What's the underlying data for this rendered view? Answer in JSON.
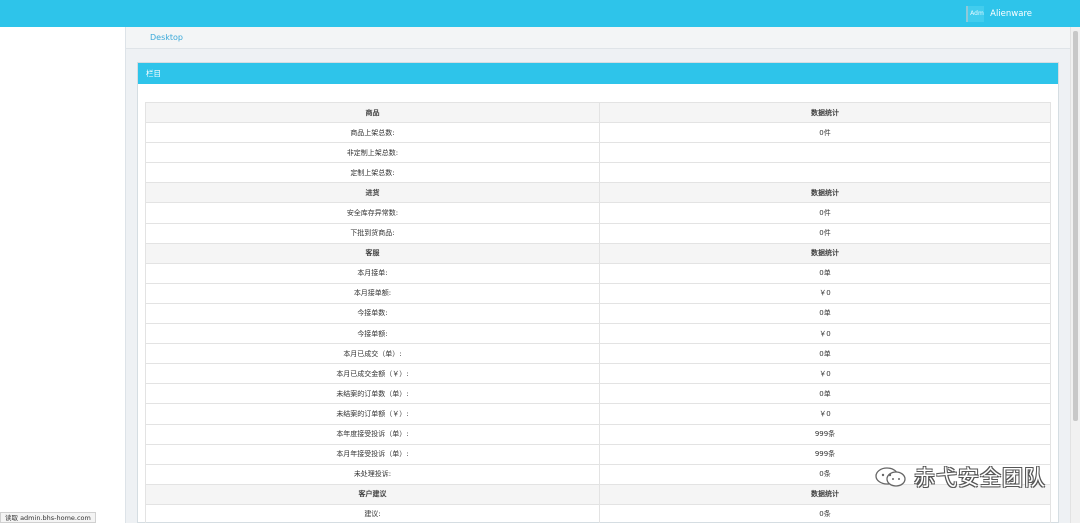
{
  "header": {
    "avatar_text": "Adm",
    "username": "Alienware"
  },
  "breadcrumb": {
    "label": "Desktop"
  },
  "panel": {
    "title": "栏目"
  },
  "stats_table": {
    "sections": [
      {
        "title": "商品",
        "stat_header": "数据统计",
        "rows": [
          {
            "label": "商品上架总数:",
            "value": "0件"
          },
          {
            "label": "非定制上架总数:",
            "value": ""
          },
          {
            "label": "定制上架总数:",
            "value": ""
          }
        ]
      },
      {
        "title": "进货",
        "stat_header": "数据统计",
        "rows": [
          {
            "label": "安全库存异常数:",
            "value": "0件"
          },
          {
            "label": "下批到货商品:",
            "value": "0件"
          }
        ]
      },
      {
        "title": "客服",
        "stat_header": "数据统计",
        "rows": [
          {
            "label": "本月接单:",
            "value": "0单"
          },
          {
            "label": "本月接单额:",
            "value": "￥0"
          },
          {
            "label": "今接单数:",
            "value": "0单"
          },
          {
            "label": "今接单额:",
            "value": "￥0"
          },
          {
            "label": "本月已成交（单）:",
            "value": "0单"
          },
          {
            "label": "本月已成交金额（￥）:",
            "value": "￥0"
          },
          {
            "label": "未结案的订单数（单）:",
            "value": "0单"
          },
          {
            "label": "未结案的订单额（￥）:",
            "value": "￥0"
          },
          {
            "label": "本年度接受投诉（单）:",
            "value": "999条"
          },
          {
            "label": "本月年接受投诉（单）:",
            "value": "999条"
          },
          {
            "label": "未处理投诉:",
            "value": "0条"
          }
        ]
      },
      {
        "title": "客户建议",
        "stat_header": "数据统计",
        "rows": [
          {
            "label": "建议:",
            "value": "0条"
          }
        ]
      }
    ]
  },
  "status_bar": {
    "text": "读取 admin.bhs-home.com"
  },
  "watermark": {
    "text": "赤弋安全团队"
  }
}
